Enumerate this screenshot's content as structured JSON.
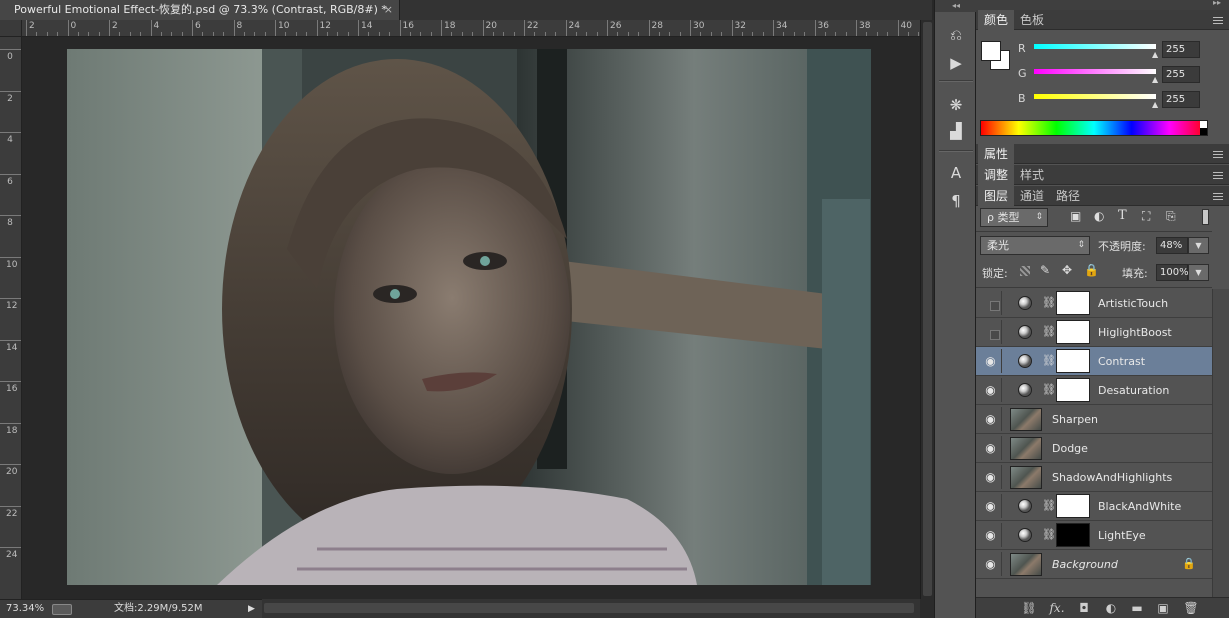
{
  "document": {
    "tab_title": "Powerful Emotional Effect-恢复的.psd @ 73.3% (Contrast, RGB/8#) *",
    "close_glyph": "×"
  },
  "ruler": {
    "h_labels": [
      "2",
      "0",
      "2",
      "4",
      "6",
      "8",
      "10",
      "12",
      "14",
      "16",
      "18",
      "20",
      "22",
      "24",
      "26",
      "28",
      "30",
      "32",
      "34",
      "36",
      "38",
      "40"
    ],
    "v_labels": [
      "0",
      "2",
      "4",
      "6",
      "8",
      "10",
      "12",
      "14",
      "16",
      "18",
      "20",
      "22",
      "24"
    ]
  },
  "status": {
    "zoom": "73.34%",
    "doc_info": "文档:2.29M/9.52M"
  },
  "toolstrip": {
    "collapse": "◂◂",
    "icons": [
      "history-icon",
      "play-action-icon",
      "brush-settings-icon",
      "histogram-icon",
      "character-icon",
      "paragraph-icon"
    ],
    "glyphs": [
      "⎌",
      "▶",
      "❋",
      "▟",
      "A",
      "¶"
    ]
  },
  "color_panel": {
    "tabs": [
      "颜色",
      "色板"
    ],
    "channels": [
      {
        "label": "R",
        "value": "255",
        "color": "#00ffff"
      },
      {
        "label": "G",
        "value": "255",
        "color": "#ff00ff"
      },
      {
        "label": "B",
        "value": "255",
        "color": "#ffff00"
      }
    ]
  },
  "properties_panel": {
    "tab": "属性"
  },
  "adjust_panel": {
    "tabs": [
      "调整",
      "样式"
    ]
  },
  "layers_panel": {
    "tabs": [
      "图层",
      "通道",
      "路径"
    ],
    "filter_label": "ρ 类型",
    "blend_mode": "柔光",
    "opacity_label": "不透明度:",
    "opacity_value": "48%",
    "lock_label": "锁定:",
    "fill_label": "填充:",
    "fill_value": "100%",
    "layers": [
      {
        "name": "ArtisticTouch",
        "visible": false,
        "type": "adjustment",
        "mask": "white",
        "selected": false
      },
      {
        "name": "HiglightBoost",
        "visible": false,
        "type": "adjustment",
        "mask": "white",
        "selected": false
      },
      {
        "name": "Contrast",
        "visible": true,
        "type": "adjustment",
        "mask": "white",
        "selected": true
      },
      {
        "name": "Desaturation",
        "visible": true,
        "type": "adjustment",
        "mask": "white",
        "selected": false
      },
      {
        "name": "Sharpen",
        "visible": true,
        "type": "pixel",
        "selected": false
      },
      {
        "name": "Dodge",
        "visible": true,
        "type": "pixel",
        "selected": false
      },
      {
        "name": "ShadowAndHighlights",
        "visible": true,
        "type": "pixel",
        "selected": false
      },
      {
        "name": "BlackAndWhite",
        "visible": true,
        "type": "adjustment",
        "mask": "white",
        "selected": false
      },
      {
        "name": "LightEye",
        "visible": true,
        "type": "adjustment",
        "mask": "black",
        "selected": false
      },
      {
        "name": "Background",
        "visible": true,
        "type": "background",
        "selected": false,
        "locked": true
      }
    ],
    "footer_icons": [
      "link-layers-icon",
      "fx-icon",
      "add-mask-icon",
      "new-adjustment-icon",
      "new-group-icon",
      "new-layer-icon",
      "delete-layer-icon"
    ],
    "footer_glyphs": [
      "⛓",
      "fx.",
      "◘",
      "◐",
      "▬",
      "▣",
      "🗑"
    ]
  },
  "colors": {
    "accent_selected": "#6b7f99",
    "panel_bg": "#535353",
    "canvas_bg": "#282828"
  }
}
